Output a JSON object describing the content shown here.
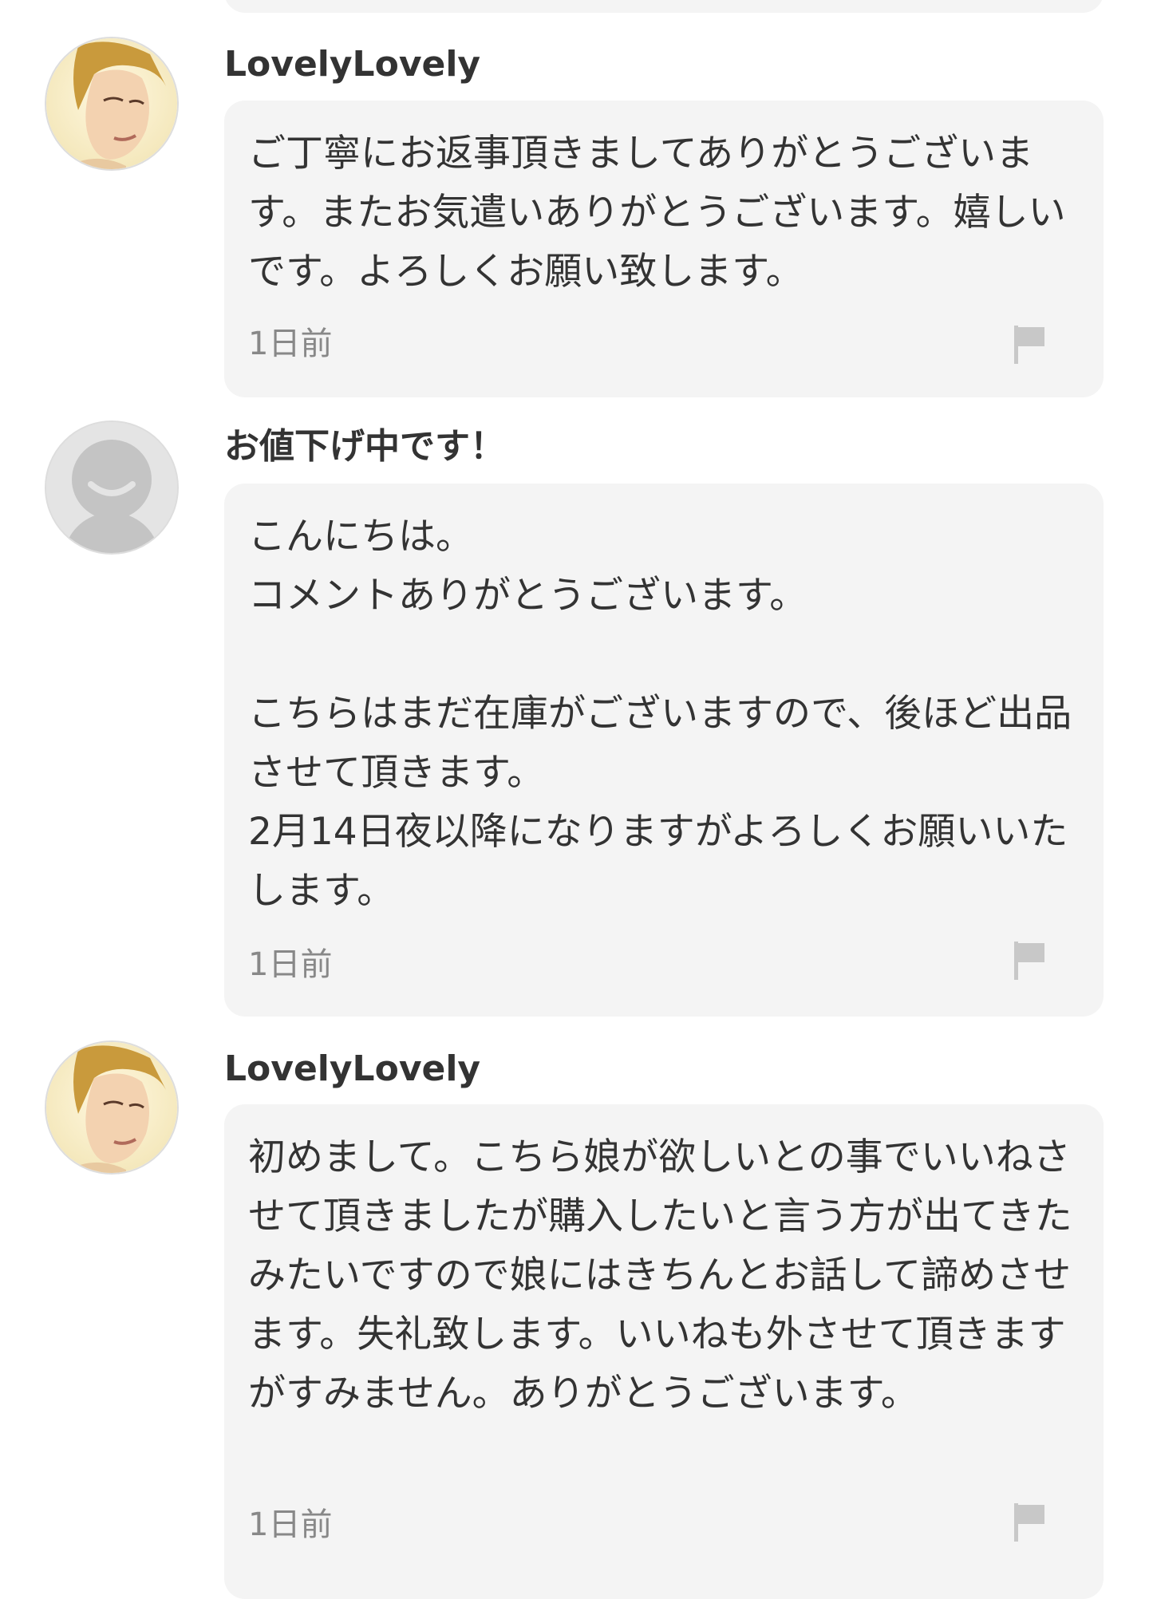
{
  "comments": [
    {
      "username": "LovelyLovely",
      "avatar": "user-photo-avatar",
      "message": "ご丁寧にお返事頂きましてありがとうございます。またお気遣いありがとうございます。嬉しいです。よろしくお願い致します。",
      "time": "1日前",
      "flag_icon": "flag-icon"
    },
    {
      "username": "お値下げ中です！",
      "avatar": "default-user-avatar",
      "message": "こんにちは。\nコメントありがとうございます。\n\nこちらはまだ在庫がございますので、後ほど出品させて頂きます。\n2月14日夜以降になりますがよろしくお願いいたします。",
      "time": "1日前",
      "flag_icon": "flag-icon"
    },
    {
      "username": "LovelyLovely",
      "avatar": "user-photo-avatar",
      "message": "初めまして。こちら娘が欲しいとの事でいいねさせて頂きましたが購入したいと言う方が出てきたみたいですので娘にはきちんとお話して諦めさせます。失礼致します。いいねも外させて頂きますがすみません。ありがとうございます。",
      "time": "1日前",
      "flag_icon": "flag-icon"
    }
  ],
  "colors": {
    "bubble_bg": "#f4f4f4",
    "text": "#333333",
    "muted": "#888888",
    "flag": "#c8c8c8"
  }
}
